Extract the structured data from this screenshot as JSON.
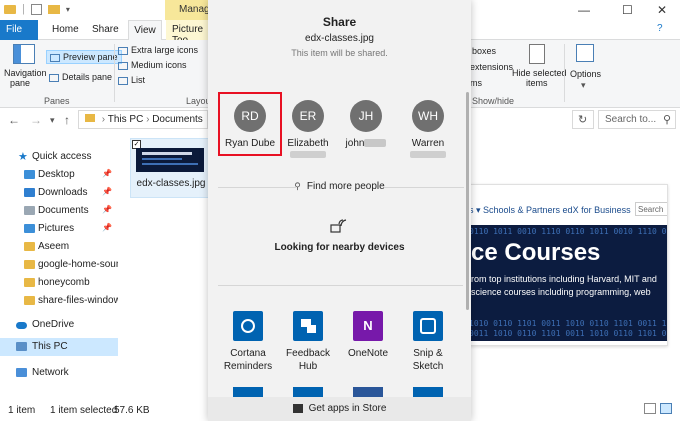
{
  "titlebar": {
    "manage_label": "Manage",
    "minimize": "—",
    "maximize": "☐",
    "close": "✕",
    "help": "?"
  },
  "tabs": {
    "file": "File",
    "home": "Home",
    "share": "Share",
    "view": "View",
    "picture_tools": "Picture Too"
  },
  "ribbon": {
    "navigation_pane": "Navigation\npane",
    "navigation_pane_1": "Navigation",
    "navigation_pane_2": "pane",
    "preview_pane": "Preview pane",
    "details_pane": "Details pane",
    "panes_group": "Panes",
    "extra_large_icons": "Extra large icons",
    "medium_icons": "Medium icons",
    "list": "List",
    "layout_group": "Layou",
    "boxes": "boxes",
    "extensions": "extensions",
    "items": "ms",
    "hide_selected_1": "Hide selected",
    "hide_selected_2": "items",
    "options": "Options",
    "show_hide_group": "Show/hide"
  },
  "address": {
    "path_this_pc": "This PC",
    "path_documents": "Documents",
    "search_placeholder": "Search to..."
  },
  "navpane": {
    "items": [
      {
        "label": "Quick access"
      },
      {
        "label": "Desktop"
      },
      {
        "label": "Downloads"
      },
      {
        "label": "Documents"
      },
      {
        "label": "Pictures"
      },
      {
        "label": "Aseem"
      },
      {
        "label": "google-home-soun"
      },
      {
        "label": "honeycomb"
      },
      {
        "label": "share-files-windows"
      },
      {
        "label": "OneDrive"
      },
      {
        "label": "This PC"
      },
      {
        "label": "Network"
      }
    ]
  },
  "file": {
    "name": "edx-classes.jpg"
  },
  "preview": {
    "nav_text": "s ▾ Schools & Partners   edX for Business",
    "search": "Search",
    "heading": "ce Courses",
    "line1": "rom top institutions including Harvard, MIT and",
    "line2": "science courses including programming, web"
  },
  "status": {
    "count": "1 item",
    "selected": "1 item selected",
    "size": "57.6 KB"
  },
  "share": {
    "title": "Share",
    "filename": "edx-classes.jpg",
    "note": "This item will be shared.",
    "contacts": [
      {
        "initials": "RD",
        "name": "Ryan Dube"
      },
      {
        "initials": "ER",
        "name": "Elizabeth"
      },
      {
        "initials": "JH",
        "name": "john"
      },
      {
        "initials": "WH",
        "name": "Warren"
      }
    ],
    "find_more": "Find more people",
    "nearby": "Looking for nearby devices",
    "apps": [
      {
        "name1": "Cortana",
        "name2": "Reminders",
        "color": "#0063b1"
      },
      {
        "name1": "Feedback",
        "name2": "Hub",
        "color": "#0063b1"
      },
      {
        "name1": "OneNote",
        "name2": "",
        "color": "#7719aa"
      },
      {
        "name1": "Snip &",
        "name2": "Sketch",
        "color": "#0063b1"
      }
    ],
    "store": "Get apps in Store"
  }
}
